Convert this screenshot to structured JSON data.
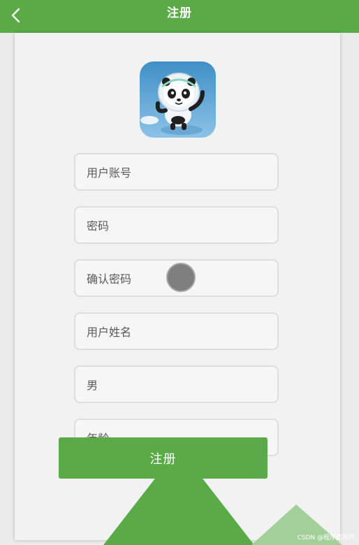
{
  "header": {
    "title": "注册",
    "back_icon": "chevron-left-icon"
  },
  "avatar": {
    "icon": "panda-mascot-icon"
  },
  "form": {
    "fields": [
      {
        "name": "account-field",
        "placeholder": "用户账号"
      },
      {
        "name": "password-field",
        "placeholder": "密码"
      },
      {
        "name": "confirm-password-field",
        "placeholder": "确认密码"
      },
      {
        "name": "user-name-field",
        "placeholder": "用户姓名"
      },
      {
        "name": "gender-field",
        "value": "男"
      },
      {
        "name": "age-field",
        "placeholder": "年龄"
      }
    ],
    "submit_label": "注册"
  },
  "watermark": "CSDN @程序员阿芦"
}
